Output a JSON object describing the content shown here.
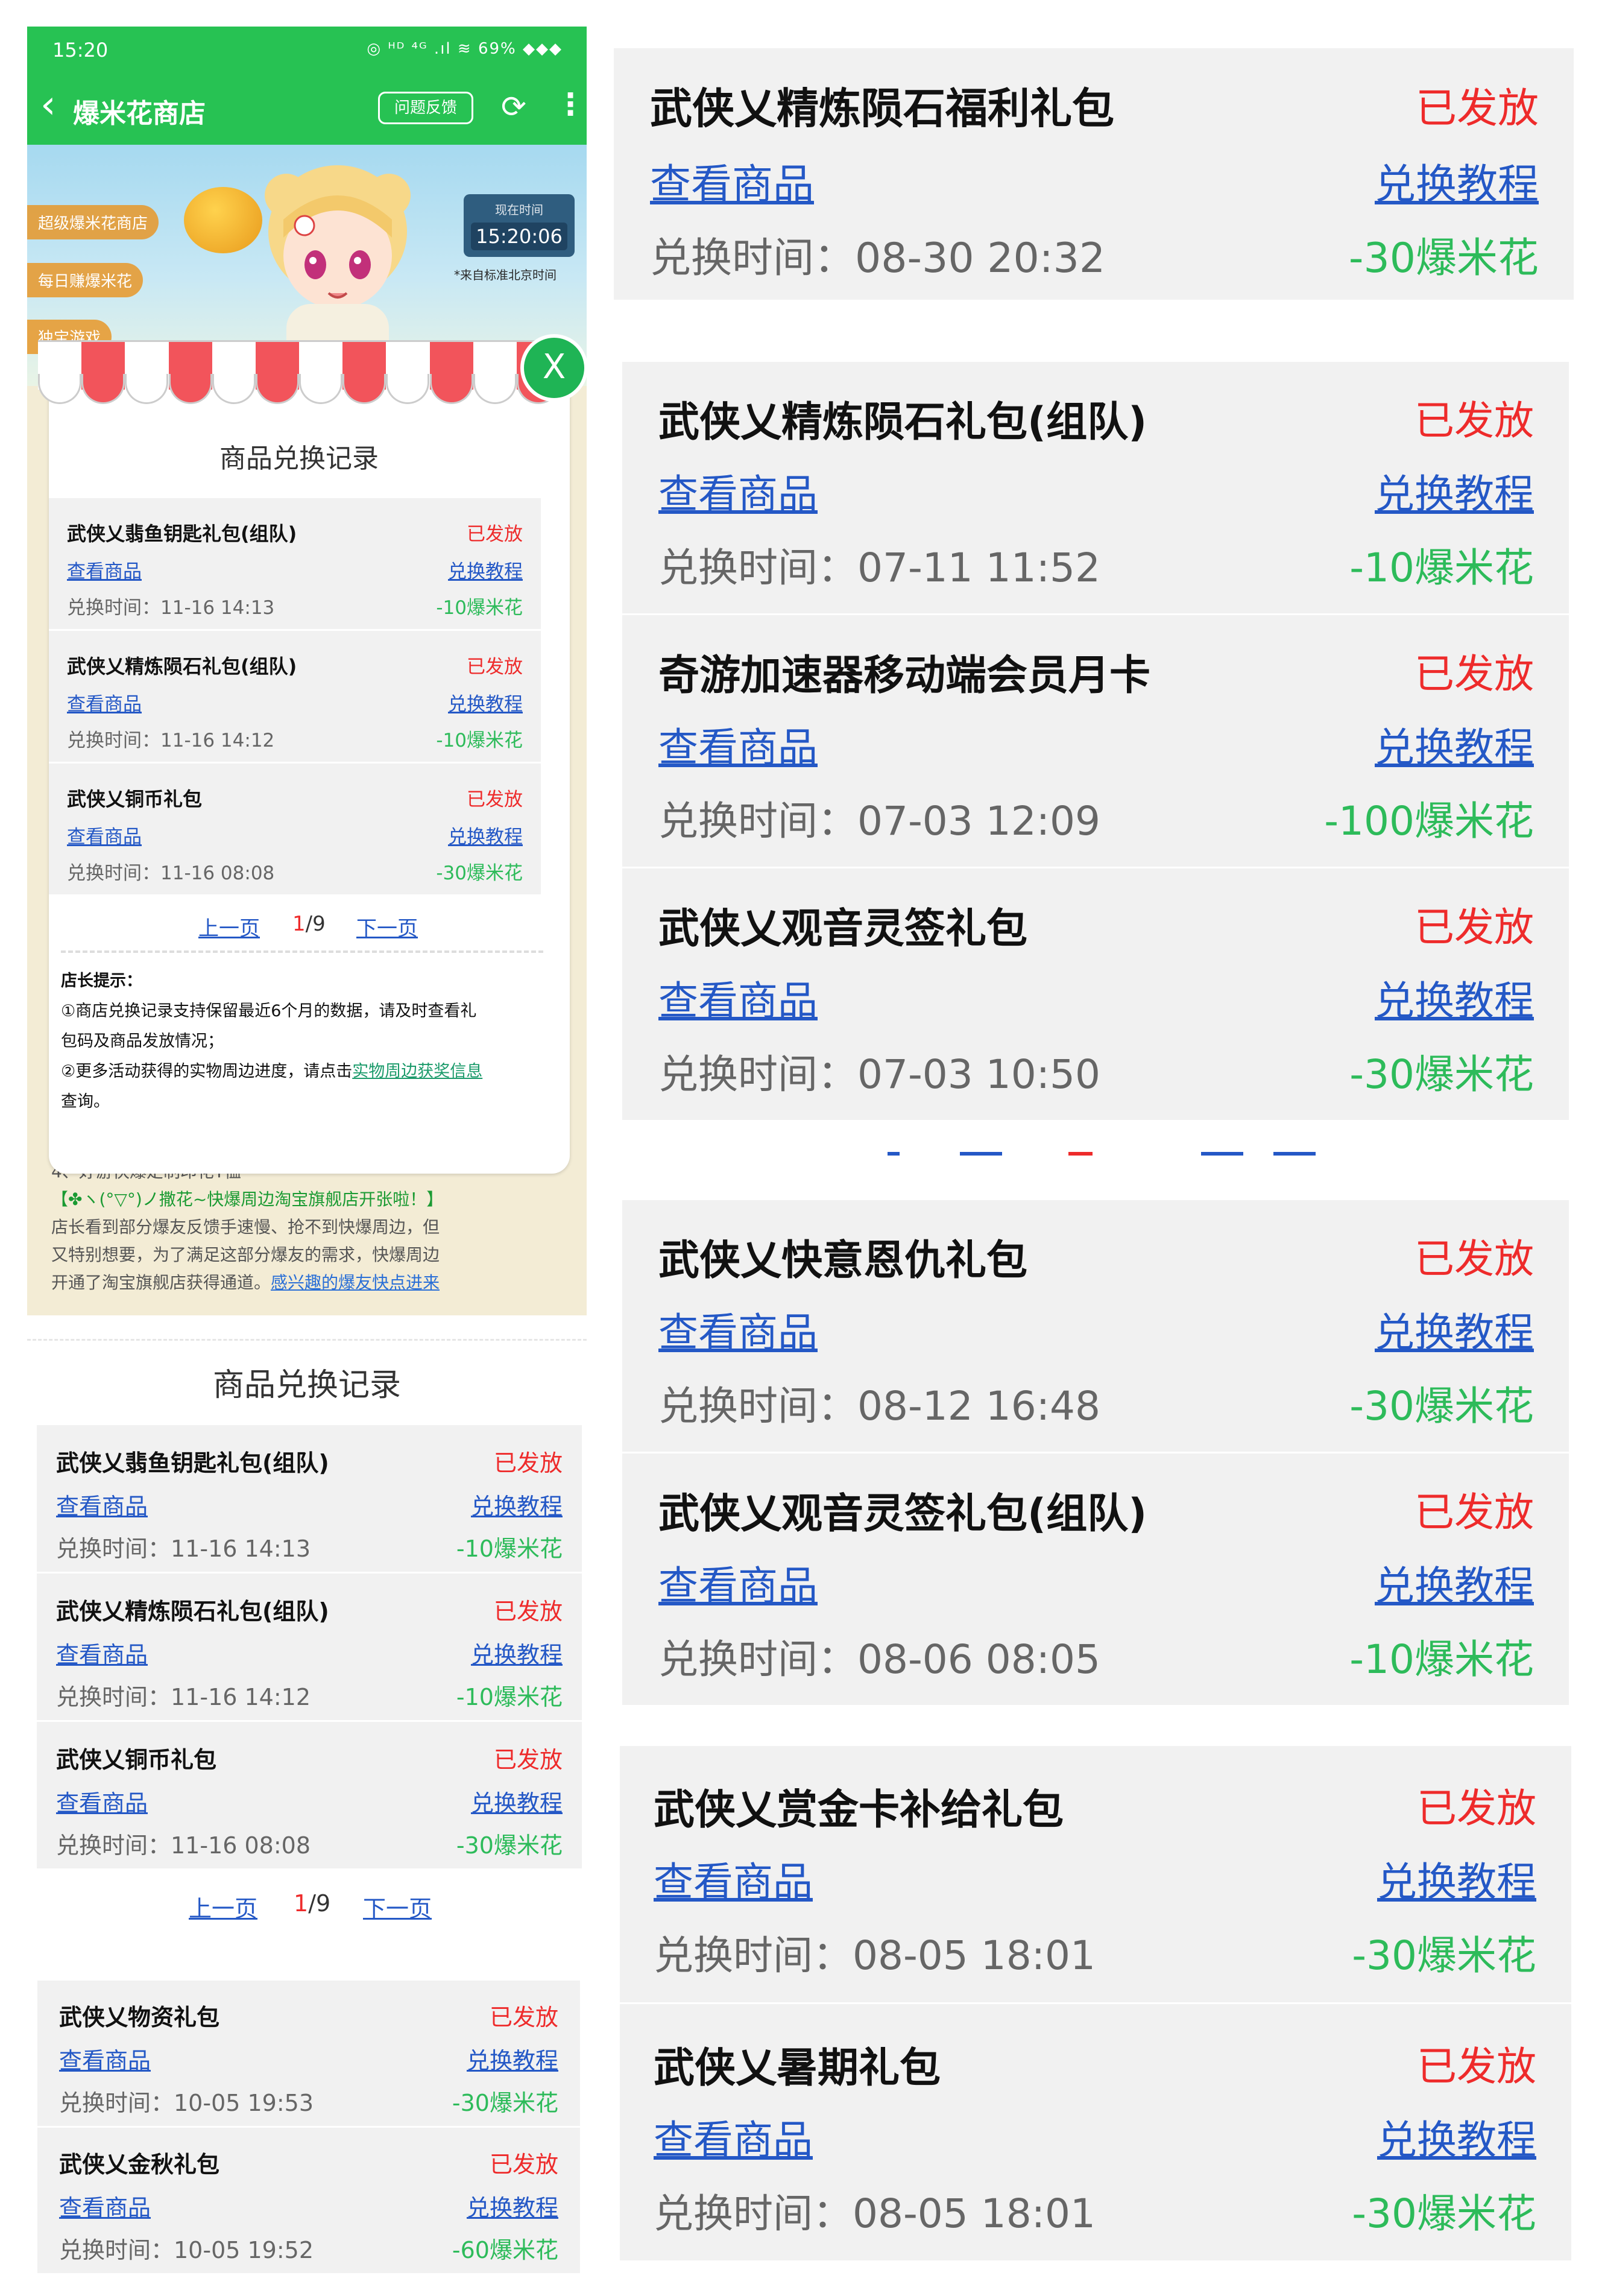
{
  "phone": {
    "status_time": "15:20",
    "status_icons": "◎ ᴴᴰ ⁴ᴳ .ıl ≋ 69% ◆◆◆",
    "nav_title": "爆米花商店",
    "feedback_label": "问题反馈",
    "hero": {
      "tag1": "超级爆米花商店",
      "tag2": "每日赚爆米花",
      "tag3": "独宝游戏",
      "clock_label": "现在时间",
      "clock_value": "15:20:06",
      "clock_note": "*来自标准北京时间"
    },
    "bottom_tips": {
      "line1": "4、好游快爆定制印花T恤",
      "line2": "【✤ヽ(°▽°)ノ撒花~快爆周边淘宝旗舰店开张啦！】",
      "line3": "店长看到部分爆友反馈手速慢、抢不到快爆周边，但",
      "line4": "又特别想要，为了满足这部分爆友的需求，快爆周边",
      "line5a": "开通了淘宝旗舰店获得通道。",
      "line5b": "感兴趣的爆友快点进来"
    },
    "modal": {
      "close_label": "X",
      "title": "商品兑换记录",
      "records": [
        {
          "name": "武侠乂翡鱼钥匙礼包(组队)",
          "status": "已发放",
          "view": "查看商品",
          "tutorial": "兑换教程",
          "time": "兑换时间：11-16 14:13",
          "cost": "-10爆米花"
        },
        {
          "name": "武侠乂精炼陨石礼包(组队)",
          "status": "已发放",
          "view": "查看商品",
          "tutorial": "兑换教程",
          "time": "兑换时间：11-16 14:12",
          "cost": "-10爆米花"
        },
        {
          "name": "武侠乂铜币礼包",
          "status": "已发放",
          "view": "查看商品",
          "tutorial": "兑换教程",
          "time": "兑换时间：11-16 08:08",
          "cost": "-30爆米花"
        }
      ],
      "pager": {
        "prev": "上一页",
        "current": "1",
        "total": "/9",
        "next": "下一页"
      },
      "note_head": "店长提示：",
      "note1": "①商店兑换记录支持保留最近6个月的数据，请及时查看礼",
      "note2": "包码及商品发放情况；",
      "note3a": "②更多活动获得的实物周边进度，请点击",
      "note3b": "实物周边获奖信息",
      "note4": "查询。"
    }
  },
  "panel_b": {
    "title": "商品兑换记录",
    "records": [
      {
        "name": "武侠乂翡鱼钥匙礼包(组队)",
        "status": "已发放",
        "view": "查看商品",
        "tutorial": "兑换教程",
        "time": "兑换时间：11-16 14:13",
        "cost": "-10爆米花"
      },
      {
        "name": "武侠乂精炼陨石礼包(组队)",
        "status": "已发放",
        "view": "查看商品",
        "tutorial": "兑换教程",
        "time": "兑换时间：11-16 14:12",
        "cost": "-10爆米花"
      },
      {
        "name": "武侠乂铜币礼包",
        "status": "已发放",
        "view": "查看商品",
        "tutorial": "兑换教程",
        "time": "兑换时间：11-16 08:08",
        "cost": "-30爆米花"
      }
    ],
    "pager": {
      "prev": "上一页",
      "current": "1",
      "total": "/9",
      "next": "下一页"
    }
  },
  "panel_c": {
    "records": [
      {
        "name": "武侠乂物资礼包",
        "status": "已发放",
        "view": "查看商品",
        "tutorial": "兑换教程",
        "time": "兑换时间：10-05 19:53",
        "cost": "-30爆米花"
      },
      {
        "name": "武侠乂金秋礼包",
        "status": "已发放",
        "view": "查看商品",
        "tutorial": "兑换教程",
        "time": "兑换时间：10-05 19:52",
        "cost": "-60爆米花"
      }
    ]
  },
  "panel_r1": {
    "records": [
      {
        "name": "武侠乂精炼陨石福利礼包",
        "status": "已发放",
        "view": "查看商品",
        "tutorial": "兑换教程",
        "time": "兑换时间：08-30 20:32",
        "cost": "-30爆米花"
      }
    ]
  },
  "panel_r2": {
    "records": [
      {
        "name": "武侠乂精炼陨石礼包(组队)",
        "status": "已发放",
        "view": "查看商品",
        "tutorial": "兑换教程",
        "time": "兑换时间：07-11 11:52",
        "cost": "-10爆米花"
      },
      {
        "name": "奇游加速器移动端会员月卡",
        "status": "已发放",
        "view": "查看商品",
        "tutorial": "兑换教程",
        "time": "兑换时间：07-03 12:09",
        "cost": "-100爆米花"
      },
      {
        "name": "武侠乂观音灵签礼包",
        "status": "已发放",
        "view": "查看商品",
        "tutorial": "兑换教程",
        "time": "兑换时间：07-03 10:50",
        "cost": "-30爆米花"
      }
    ]
  },
  "panel_r3": {
    "records": [
      {
        "name": "武侠乂快意恩仇礼包",
        "status": "已发放",
        "view": "查看商品",
        "tutorial": "兑换教程",
        "time": "兑换时间：08-12 16:48",
        "cost": "-30爆米花"
      },
      {
        "name": "武侠乂观音灵签礼包(组队)",
        "status": "已发放",
        "view": "查看商品",
        "tutorial": "兑换教程",
        "time": "兑换时间：08-06 08:05",
        "cost": "-10爆米花"
      }
    ]
  },
  "panel_r4": {
    "records": [
      {
        "name": "武侠乂赏金卡补给礼包",
        "status": "已发放",
        "view": "查看商品",
        "tutorial": "兑换教程",
        "time": "兑换时间：08-05 18:01",
        "cost": "-30爆米花"
      },
      {
        "name": "武侠乂暑期礼包",
        "status": "已发放",
        "view": "查看商品",
        "tutorial": "兑换教程",
        "time": "兑换时间：08-05 18:01",
        "cost": "-30爆米花"
      }
    ]
  },
  "colors": {
    "brand_green": "#27c253",
    "status_red": "#ee2b2b",
    "link_blue": "#2458c6",
    "cost_green": "#2dbb5a",
    "row_bg": "#f1f1f1"
  }
}
